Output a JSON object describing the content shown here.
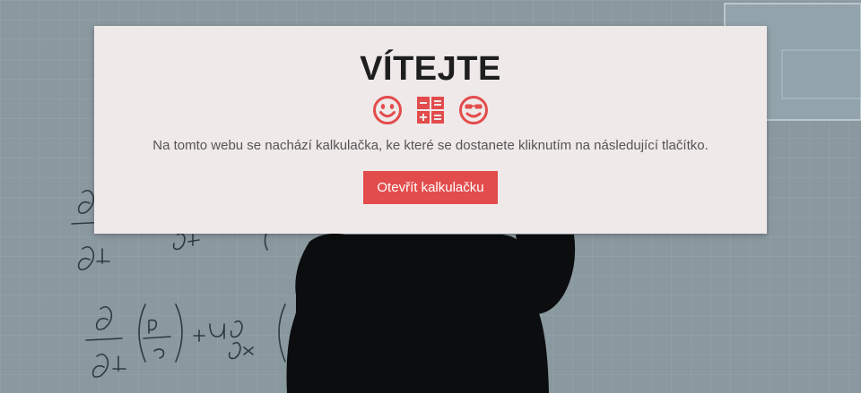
{
  "welcome": {
    "title": "VÍTEJTE",
    "icons": [
      "smile-icon",
      "calculator-icon",
      "cool-smile-icon"
    ],
    "description": "Na tomto webu se nachází kalkulačka, ke které se dostanete kliknutím na následující tlačítko.",
    "button_label": "Otevřít kalkulačku"
  },
  "colors": {
    "accent": "#e34c4c",
    "card_background": "#efe9e9",
    "title_text": "#1e1e1e",
    "body_text": "#555555"
  }
}
